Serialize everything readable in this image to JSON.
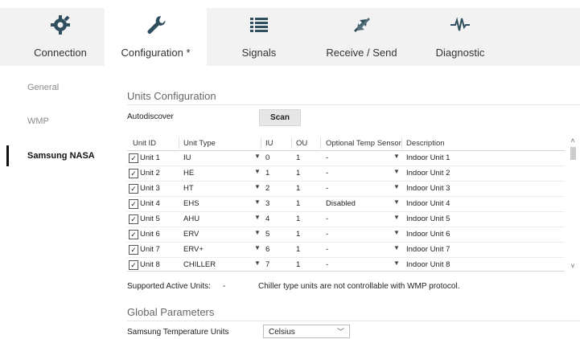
{
  "tabs": [
    {
      "label": "Connection",
      "icon": "gear-plug-icon",
      "active": false
    },
    {
      "label": "Configuration *",
      "icon": "wrench-icon",
      "active": true
    },
    {
      "label": "Signals",
      "icon": "list-icon",
      "active": false
    },
    {
      "label": "Receive / Send",
      "icon": "transfer-icon",
      "active": false
    },
    {
      "label": "Diagnostic",
      "icon": "pulse-icon",
      "active": false
    }
  ],
  "sidebar": {
    "items": [
      {
        "label": "General",
        "active": false
      },
      {
        "label": "WMP",
        "active": false
      },
      {
        "label": "Samsung NASA",
        "active": true
      }
    ]
  },
  "units_config": {
    "title": "Units Configuration",
    "autodiscover_label": "Autodiscover",
    "scan_label": "Scan"
  },
  "table": {
    "headers": [
      "Unit ID",
      "Unit Type",
      "IU",
      "OU",
      "Optional Temp Sensor",
      "Description"
    ],
    "rows": [
      {
        "id": "Unit 1",
        "type": "IU",
        "iu": "0",
        "ou": "1",
        "sensor": "-",
        "desc": "Indoor Unit 1"
      },
      {
        "id": "Unit 2",
        "type": "HE",
        "iu": "1",
        "ou": "1",
        "sensor": "-",
        "desc": "Indoor Unit 2"
      },
      {
        "id": "Unit 3",
        "type": "HT",
        "iu": "2",
        "ou": "1",
        "sensor": "-",
        "desc": "Indoor Unit 3"
      },
      {
        "id": "Unit 4",
        "type": "EHS",
        "iu": "3",
        "ou": "1",
        "sensor": "Disabled",
        "desc": "Indoor Unit 4"
      },
      {
        "id": "Unit 5",
        "type": "AHU",
        "iu": "4",
        "ou": "1",
        "sensor": "-",
        "desc": "Indoor Unit 5"
      },
      {
        "id": "Unit 6",
        "type": "ERV",
        "iu": "5",
        "ou": "1",
        "sensor": "-",
        "desc": "Indoor Unit 6"
      },
      {
        "id": "Unit 7",
        "type": "ERV+",
        "iu": "6",
        "ou": "1",
        "sensor": "-",
        "desc": "Indoor Unit 7"
      },
      {
        "id": "Unit 8",
        "type": "CHILLER",
        "iu": "7",
        "ou": "1",
        "sensor": "-",
        "desc": "Indoor Unit 8"
      }
    ]
  },
  "supported": {
    "label": "Supported Active Units:",
    "value": "-",
    "note": "Chiller type units are not controllable with WMP protocol."
  },
  "global_params": {
    "title": "Global Parameters",
    "temp_units_label": "Samsung Temperature Units",
    "temp_units_value": "Celsius"
  },
  "colors": {
    "tabbar_bg": "#f2f2f2",
    "active_tab_bg": "#ffffff",
    "icon_color": "#2f4f5f",
    "text": "#222222"
  }
}
